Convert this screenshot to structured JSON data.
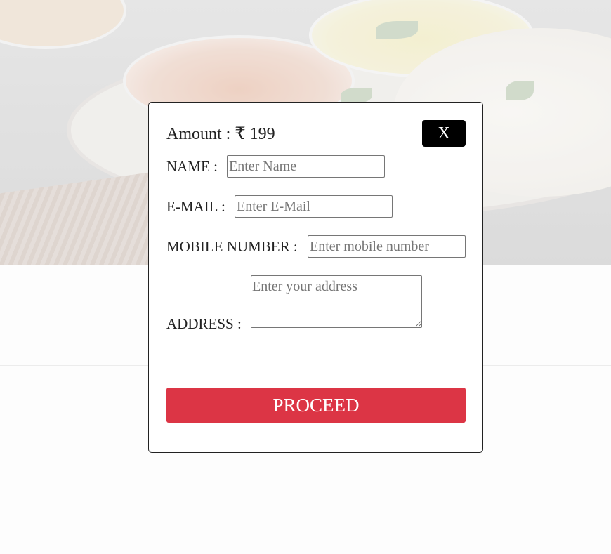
{
  "payment_modal": {
    "amount_label": "Amount : ₹ 199",
    "close_label": "X",
    "name": {
      "label": "NAME :",
      "placeholder": "Enter Name",
      "value": ""
    },
    "email": {
      "label": "E-MAIL :",
      "placeholder": "Enter E-Mail",
      "value": ""
    },
    "mobile": {
      "label": "MOBILE NUMBER :",
      "placeholder": "Enter mobile number",
      "value": ""
    },
    "address": {
      "label": "ADDRESS :",
      "placeholder": "Enter your address",
      "value": ""
    },
    "proceed_label": "PROCEED"
  },
  "colors": {
    "proceed_button": "#dc3545",
    "close_button": "#000000",
    "modal_background": "#ffffff"
  }
}
